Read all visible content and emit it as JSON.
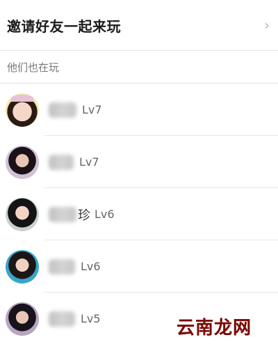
{
  "invite": {
    "title": "邀请好友一起来玩",
    "chevron": "›"
  },
  "section": {
    "title": "他们也在玩"
  },
  "friends": [
    {
      "name_suffix": "",
      "level": "Lv7",
      "avatar": "cartoon-girl-avatar"
    },
    {
      "name_suffix": "",
      "level": "Lv7",
      "avatar": "user-avatar"
    },
    {
      "name_suffix": "珍",
      "level": "Lv6",
      "avatar": "user-avatar"
    },
    {
      "name_suffix": "",
      "level": "Lv6",
      "avatar": "user-avatar"
    },
    {
      "name_suffix": "",
      "level": "Lv5",
      "avatar": "user-avatar"
    }
  ],
  "watermark": {
    "text": "云南龙网"
  },
  "colors": {
    "divider": "#e6e6e6",
    "text_secondary": "#777777",
    "watermark": "#7b0c07"
  }
}
